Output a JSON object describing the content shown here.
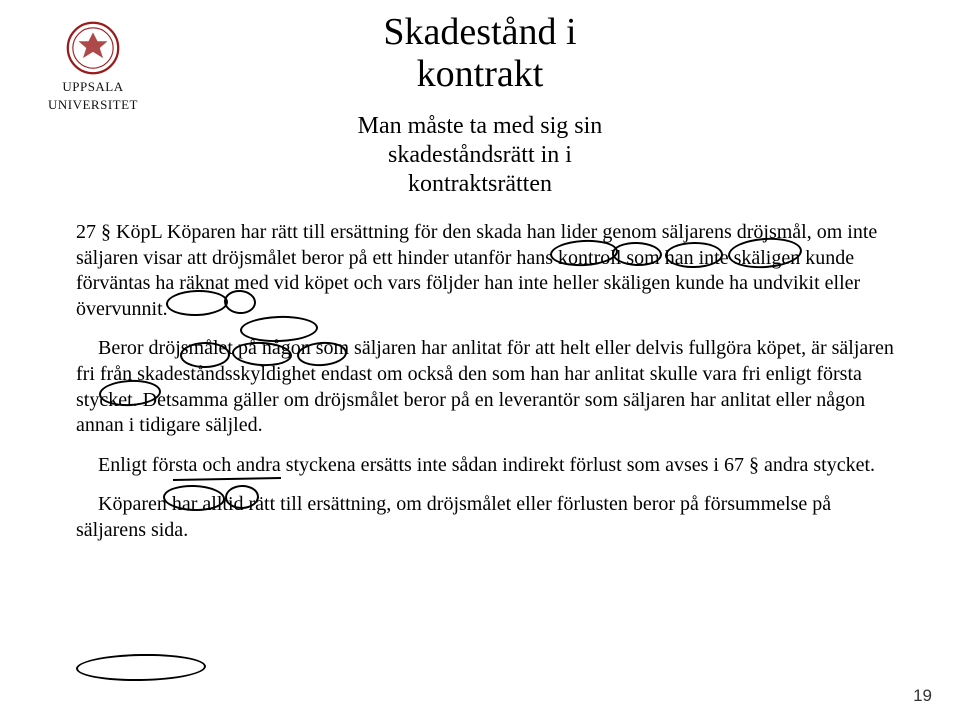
{
  "logo": {
    "line1": "UPPSALA",
    "line2": "UNIVERSITET"
  },
  "title": "Skadestånd i\nkontrakt",
  "subtitle": "Man måste ta med sig sin\nskadeståndsrätt in i\nkontraktsrätten",
  "paragraphs": [
    "27 § KöpL Köparen har rätt till ersättning för den skada han lider genom säljarens dröjsmål, om inte säljaren visar att dröjsmålet beror på ett hinder utanför hans kontroll som han inte skäligen kunde förväntas ha räknat med vid köpet och vars följder han inte heller skäligen kunde ha undvikit eller övervunnit.",
    "Beror dröjsmålet på någon som säljaren har anlitat för att helt eller delvis fullgöra köpet, är säljaren fri från skadeståndsskyldighet endast om också den som han har anlitat skulle vara fri enligt första stycket. Detsamma gäller om dröjsmålet beror på en leverantör som säljaren har anlitat eller någon annan i tidigare säljled.",
    "Enligt första och andra styckena ersätts inte sådan indirekt förlust som avses i 67 § andra stycket.",
    "Köparen har alltid rätt till ersättning, om dröjsmålet eller förlusten beror på försummelse på säljarens sida."
  ],
  "page_number": "19"
}
